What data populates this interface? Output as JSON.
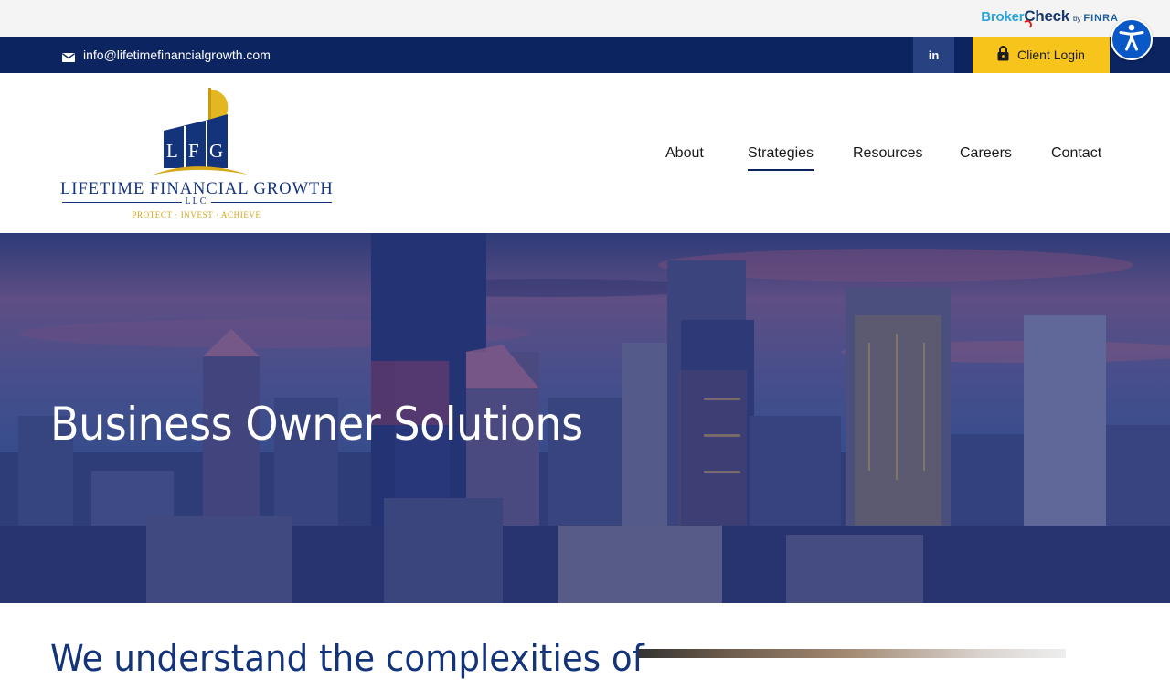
{
  "brokercheck": {
    "broker": "Broker",
    "check": "Check",
    "by": "by",
    "finra": "FINRA"
  },
  "contact_bar": {
    "email": "info@lifetimefinancialgrowth.com",
    "linkedin": "in",
    "client_login": "Client Login"
  },
  "logo": {
    "monogram": "LFG",
    "name": "LIFETIME FINANCIAL GROWTH",
    "llc": "LLC",
    "tagline": "PROTECT · INVEST · ACHIEVE"
  },
  "nav": {
    "items": [
      {
        "label": "About"
      },
      {
        "label": "Strategies",
        "active": true
      },
      {
        "label": "Resources"
      },
      {
        "label": "Careers"
      },
      {
        "label": "Contact"
      }
    ]
  },
  "hero": {
    "title": "Business Owner Solutions"
  },
  "intro": {
    "heading": "We understand the complexities of"
  },
  "colors": {
    "navy": "#0c2460",
    "gold": "#f7c41c",
    "accessibility_blue": "#0a58c7",
    "heading_blue": "#13347a"
  },
  "icons": {
    "email": "envelope-icon",
    "linkedin": "linkedin-icon",
    "login": "lock-icon",
    "accessibility": "accessibility-person-icon"
  }
}
